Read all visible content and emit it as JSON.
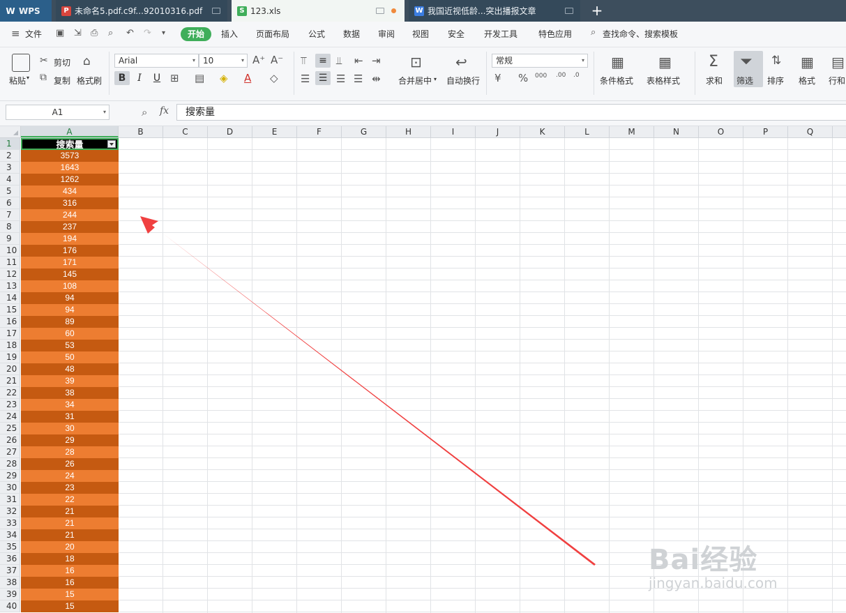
{
  "tabs": [
    {
      "label": "WPS",
      "icon": "wps-logo-icon"
    },
    {
      "label": "未命名5.pdf.c9f...92010316.pdf",
      "icon": "pdf-icon"
    },
    {
      "label": "123.xls",
      "icon": "spreadsheet-icon"
    },
    {
      "label": "我国近视低龄...突出播报文章",
      "icon": "word-icon"
    }
  ],
  "menu": {
    "file": "文件",
    "items": [
      "开始",
      "插入",
      "页面布局",
      "公式",
      "数据",
      "审阅",
      "视图",
      "安全",
      "开发工具",
      "特色应用"
    ],
    "search": "查找命令、搜索模板"
  },
  "ribbon": {
    "paste": "粘贴",
    "cut": "剪切",
    "copy": "复制",
    "format_painter": "格式刷",
    "font_name": "Arial",
    "font_size": "10",
    "merge_center": "合并居中",
    "wrap_text": "自动换行",
    "number_format": "常规",
    "conditional_format": "条件格式",
    "table_style": "表格样式",
    "sum": "求和",
    "filter": "筛选",
    "sort": "排序",
    "format": "格式",
    "rows_cols": "行和"
  },
  "formula_bar": {
    "name_box": "A1",
    "fx": "fx",
    "content": "搜索量"
  },
  "sheet": {
    "columns": [
      "A",
      "B",
      "C",
      "D",
      "E",
      "F",
      "G",
      "H",
      "I",
      "J",
      "K",
      "L",
      "M",
      "N",
      "O",
      "P",
      "Q"
    ],
    "header_cell": "搜索量",
    "values": [
      "3573",
      "1643",
      "1262",
      "434",
      "316",
      "244",
      "237",
      "194",
      "176",
      "171",
      "145",
      "108",
      "94",
      "94",
      "89",
      "60",
      "53",
      "50",
      "48",
      "39",
      "38",
      "34",
      "31",
      "30",
      "29",
      "28",
      "26",
      "24",
      "23",
      "22",
      "21",
      "21",
      "21",
      "20",
      "18",
      "16",
      "16",
      "15",
      "15"
    ],
    "row_numbers": [
      "1",
      "2",
      "3",
      "4",
      "5",
      "6",
      "7",
      "8",
      "9",
      "10",
      "11",
      "12",
      "13",
      "14",
      "15",
      "16",
      "17",
      "18",
      "19",
      "20",
      "21",
      "22",
      "23",
      "24",
      "25",
      "26",
      "27",
      "28",
      "29",
      "30",
      "31",
      "32",
      "33",
      "34",
      "35",
      "36",
      "37",
      "38",
      "39",
      "40"
    ],
    "stripe_colors": [
      "#c55a11",
      "#ed7d31"
    ],
    "accent_color": "#3fae5a"
  },
  "annotation": {
    "arrow_color": "#f04040"
  },
  "watermark": {
    "brand": "Bai经验",
    "url": "jingyan.baidu.com"
  }
}
